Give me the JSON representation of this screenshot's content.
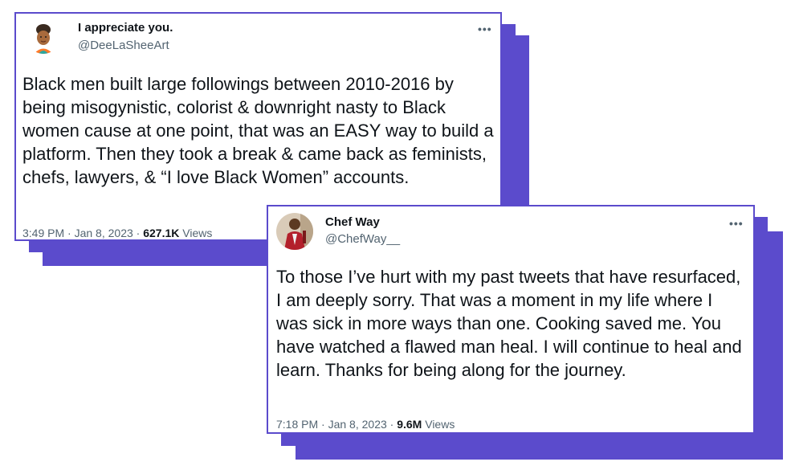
{
  "colors": {
    "accent": "#5b4bcc",
    "text_primary": "#0f1419",
    "text_secondary": "#536471"
  },
  "tweets": [
    {
      "display_name": "I appreciate you.",
      "handle": "@DeeLaSheeArt",
      "avatar_icon": "cartoon-woman-avatar",
      "text": "Black men built large followings between 2010-2016 by being misogynistic, colorist & downright nasty to Black women cause at one point, that was an EASY way to build a platform. Then they took a break & came back as feminists, chefs, lawyers, & “I love Black Women” accounts.",
      "time": "3:49 PM",
      "date": "Jan 8, 2023",
      "views_count": "627.1K",
      "views_label": "Views"
    },
    {
      "display_name": "Chef Way",
      "handle": "@ChefWay__",
      "avatar_icon": "man-in-red-jacket-avatar",
      "text": "To those I’ve hurt with my past tweets that have resurfaced, I am deeply sorry. That was a moment in my life where I was sick in more ways than one. Cooking saved me. You have watched a flawed man heal. I will continue to heal and learn. Thanks for being along for the journey.",
      "time": "7:18 PM",
      "date": "Jan 8, 2023",
      "views_count": "9.6M",
      "views_label": "Views"
    }
  ]
}
